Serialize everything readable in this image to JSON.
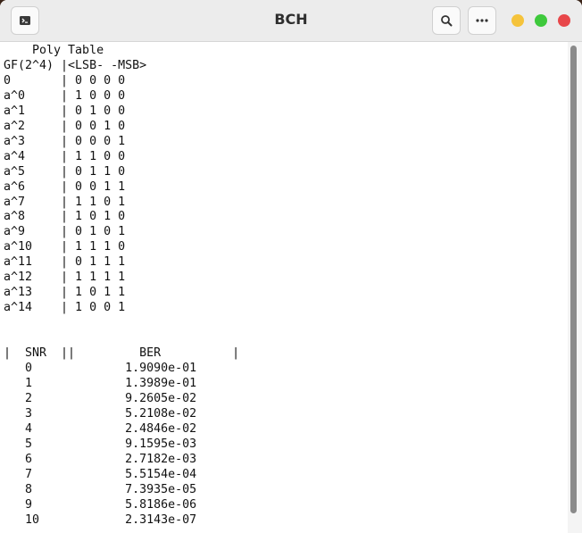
{
  "window": {
    "title": "BCH"
  },
  "colors": {
    "minimize": "#f5c33b",
    "maximize": "#3ec93c",
    "close": "#e8474a"
  },
  "icons": {
    "new_tab": "terminal-icon",
    "search": "search-icon",
    "menu": "more-icon"
  },
  "terminal": {
    "lines": [
      "    Poly Table",
      "GF(2^4) |<LSB- -MSB>",
      "0       | 0 0 0 0",
      "a^0     | 1 0 0 0",
      "a^1     | 0 1 0 0",
      "a^2     | 0 0 1 0",
      "a^3     | 0 0 0 1",
      "a^4     | 1 1 0 0",
      "a^5     | 0 1 1 0",
      "a^6     | 0 0 1 1",
      "a^7     | 1 1 0 1",
      "a^8     | 1 0 1 0",
      "a^9     | 0 1 0 1",
      "a^10    | 1 1 1 0",
      "a^11    | 0 1 1 1",
      "a^12    | 1 1 1 1",
      "a^13    | 1 0 1 1",
      "a^14    | 1 0 0 1",
      "",
      "",
      "|  SNR  ||         BER          |",
      "   0             1.9090e-01",
      "   1             1.3989e-01",
      "   2             9.2605e-02",
      "   3             5.2108e-02",
      "   4             2.4846e-02",
      "   5             9.1595e-03",
      "   6             2.7182e-03",
      "   7             5.5154e-04",
      "   8             7.3935e-05",
      "   9             5.8186e-06",
      "   10            2.3143e-07"
    ]
  }
}
